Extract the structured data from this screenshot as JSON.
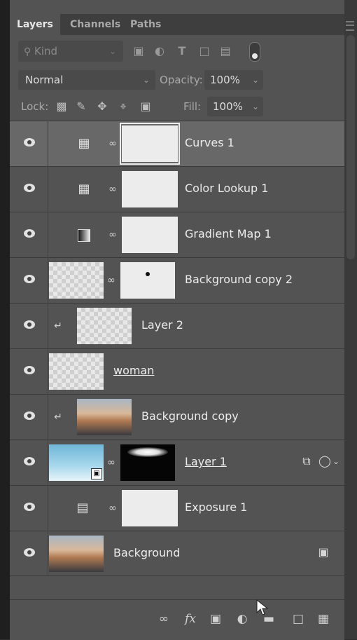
{
  "tabs": [
    "Layers",
    "Channels",
    "Paths"
  ],
  "filter": {
    "kind_label": "Kind"
  },
  "blend_mode": "Normal",
  "opacity": {
    "label": "Opacity:",
    "value": "100%"
  },
  "lock": {
    "label": "Lock:"
  },
  "fill": {
    "label": "Fill:",
    "value": "100%"
  },
  "layers": [
    {
      "name": "Curves 1",
      "kind": "curves-adjustment",
      "selected": true
    },
    {
      "name": "Color Lookup 1",
      "kind": "color-lookup-adjustment"
    },
    {
      "name": "Gradient Map 1",
      "kind": "gradient-map-adjustment"
    },
    {
      "name": "Background copy 2",
      "kind": "pixel-with-mask"
    },
    {
      "name": "Layer 2",
      "kind": "clipped-pixel"
    },
    {
      "name": "woman",
      "kind": "pixel"
    },
    {
      "name": "Background copy",
      "kind": "clipped-pixel"
    },
    {
      "name": "Layer 1",
      "kind": "smart-object-with-mask"
    },
    {
      "name": "Exposure 1",
      "kind": "exposure-adjustment"
    },
    {
      "name": "Background",
      "kind": "background-locked"
    }
  ],
  "footer_icons": [
    "link-icon",
    "fx-icon",
    "mask-icon",
    "adjustment-icon",
    "folder-icon",
    "new-layer-icon",
    "trash-icon"
  ],
  "fx_label": "fx"
}
